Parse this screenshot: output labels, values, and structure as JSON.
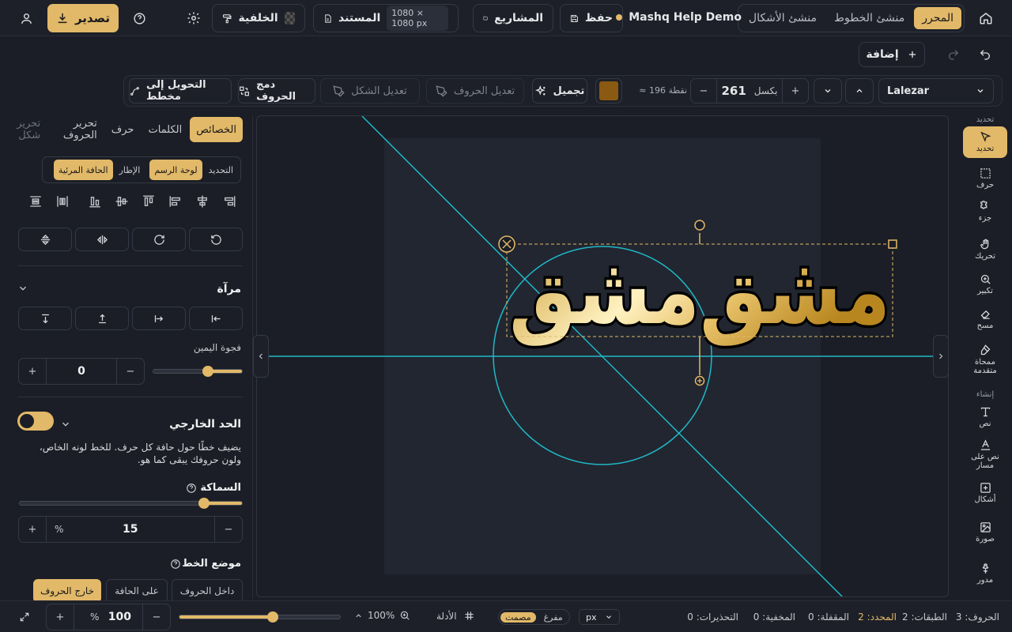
{
  "topbar": {
    "modes": [
      "المحرر",
      "منشئ الخطوط",
      "منشئ الأشكال"
    ],
    "active_mode": "المحرر",
    "project_name": "Mashq Help Demo",
    "save": "حفظ",
    "projects": "المشاريع",
    "document": "المستند",
    "document_size": "1080 × 1080 px",
    "background": "الخلفية",
    "export": "تصدير"
  },
  "row2": {
    "add": "إضافة"
  },
  "toolbar": {
    "font_name": "Lalezar",
    "size_value": "261",
    "size_unit": "بكسل",
    "points": "≈ 196 نقطة",
    "color": "#8a5a12",
    "beautify": "تجميل",
    "edit_letters": "تعديل الحروف",
    "edit_shape": "تعديل الشكل",
    "merge_letters": "دمج الحروف",
    "convert_path": "التحويل إلى مخطط"
  },
  "panel": {
    "tabs": [
      "الخصائص",
      "الكلمات",
      "حرف",
      "تحرير الحروف",
      "تحرير شكل"
    ],
    "active_tab": "الخصائص",
    "align_modes": [
      "التحديد",
      "لوحة الرسم",
      "الإطار",
      "الحافة المرئية"
    ],
    "active_align_modes": [
      "لوحة الرسم",
      "الحافة المرئية"
    ],
    "mirror_title": "مرآة",
    "right_gap_label": "فجوة اليمين",
    "right_gap_value": "0",
    "outline_title": "الحد الخارجي",
    "outline_desc": "يضيف خطًا حول حافة كل حرف. للخط لونه الخاص، ولون حروفك يبقى كما هو.",
    "thickness_label": "السماكة",
    "thickness_value": "15",
    "thickness_unit": "%",
    "thickness_level": 0.17,
    "gap_level": 0.38,
    "stroke_position_label": "موضع الخط",
    "stroke_positions": [
      "داخل الحروف",
      "على الحافة",
      "خارج الحروف"
    ],
    "active_stroke_position": "خارج الحروف"
  },
  "canvas": {
    "text": "ﻣﺸﻖﻣﺸﻖ",
    "gradient_start": "#c99a2e",
    "gradient_end": "#fff2c2",
    "guide_color": "#1fb8c8",
    "handle_color": "#e2b969"
  },
  "rail": {
    "top_label": "تحديد",
    "tools": [
      "تحديد",
      "حرف",
      "جزء",
      "تحريك",
      "تكبير",
      "مسح",
      "ممحاة متقدمة"
    ],
    "create_label": "إنشاء",
    "create_tools": [
      "نص",
      "نص على مسار",
      "أشكال",
      "صورة",
      "مدور"
    ]
  },
  "statusbar": {
    "letters": "الحروف: 3",
    "layers": "الطبقات: 2",
    "selected": "المحدد: 2",
    "locked": "المقفلة: 0",
    "hidden": "المخفية: 0",
    "warnings": "التحذيرات: 0",
    "unit": "px",
    "hollow": "مفرغ",
    "solid": "مصمت",
    "guides": "الأدلة",
    "zoom": "100%",
    "zoom_value": "100",
    "zoom_unit": "%",
    "zoom_level": 0.58
  }
}
